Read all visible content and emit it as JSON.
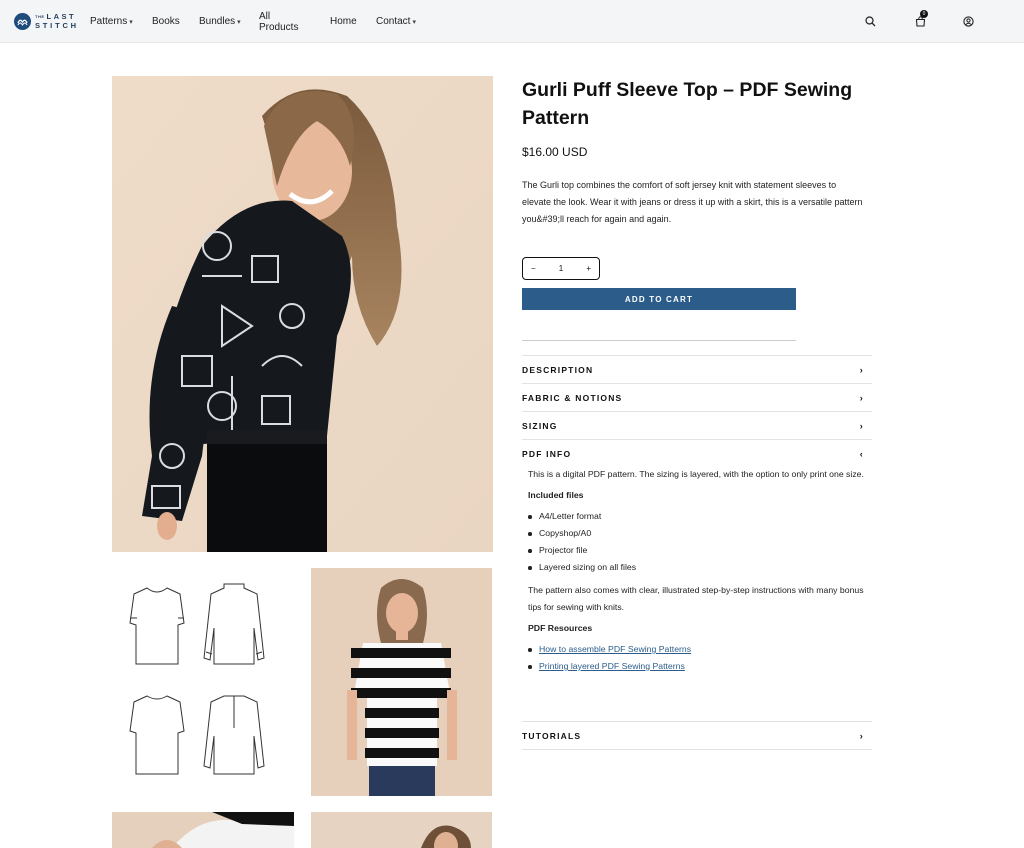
{
  "brand": {
    "logo_line1": "LAST",
    "logo_small": "THE",
    "logo_line2": "STITCH"
  },
  "nav": {
    "items": [
      {
        "label": "Patterns",
        "dropdown": true
      },
      {
        "label": "Books",
        "dropdown": false
      },
      {
        "label": "Bundles",
        "dropdown": true
      },
      {
        "label": "All Products",
        "dropdown": false
      },
      {
        "label": "Home",
        "dropdown": false
      },
      {
        "label": "Contact",
        "dropdown": true
      }
    ],
    "icons": [
      "search-icon",
      "cart-icon",
      "account-icon"
    ],
    "cart_count": "0"
  },
  "product": {
    "title": "Gurli Puff Sleeve Top – PDF Sewing Pattern",
    "price": "$16.00 USD",
    "description": "The Gurli top combines the comfort of soft jersey knit with statement sleeves to elevate the look. Wear it with jeans or dress it up with a skirt, this is a versatile pattern you&#39;ll reach for again and again.",
    "quantity": "1",
    "minus": "−",
    "plus": "+",
    "add_to_cart": "ADD TO CART"
  },
  "accordion": {
    "description": "DESCRIPTION",
    "fabric": "FABRIC & NOTIONS",
    "sizing": "SIZING",
    "pdf_info": "PDF INFO",
    "tutorials": "TUTORIALS",
    "chev_closed": "›",
    "chev_open": "‹"
  },
  "pdf_info": {
    "intro": "This is a digital PDF pattern. The sizing is layered, with the option to only print one size.",
    "included_heading": "Included files",
    "included": [
      "A4/Letter format",
      "Copyshop/A0",
      "Projector file",
      "Layered sizing on all files"
    ],
    "instructions": "The pattern also comes with clear, illustrated step-by-step instructions with many bonus tips for sewing with knits.",
    "resources_heading": "PDF Resources",
    "resources": [
      "How to assemble PDF Sewing Patterns",
      "Printing layered PDF Sewing Patterns"
    ]
  },
  "colors": {
    "accent": "#2b5c8a",
    "header_bg": "#f4f5f7",
    "photo_bg": "#e8d3c0"
  }
}
